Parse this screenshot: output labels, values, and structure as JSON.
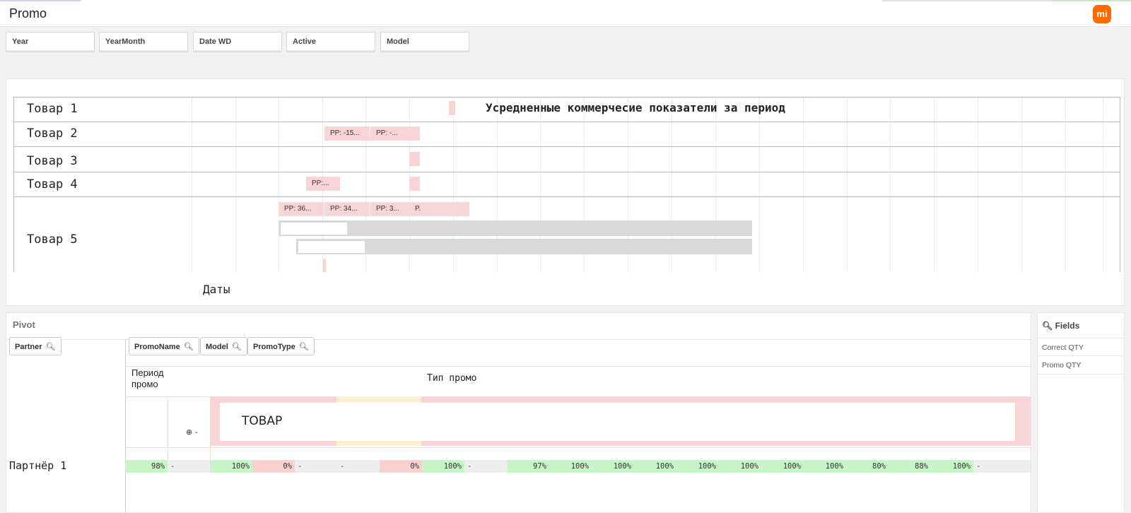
{
  "app": {
    "title": "Promo",
    "logo_text": "mi"
  },
  "filters": [
    "Year",
    "YearMonth",
    "Date WD",
    "Active",
    "Model"
  ],
  "gantt": {
    "title": "Усредненные коммерчесие показатели за период",
    "rows": [
      "Товар 1",
      "Товар 2",
      "Товар 3",
      "Товар 4",
      "Товар 5"
    ],
    "bar_labels": {
      "r2a": "PP: -15...",
      "r2b": "PP: -...",
      "r4a": "PP:...",
      "r5a": "PP: 36...",
      "r5b": "PP: 34...",
      "r5c": "PP: 3...",
      "r5d": "P."
    },
    "x_axis_label": "Даты"
  },
  "pivot": {
    "title": "Pivot",
    "row_dims": [
      "Partner"
    ],
    "col_dims": [
      "PromoName",
      "Model",
      "PromoType"
    ],
    "period_label": "Период промо",
    "type_label": "Тип промо",
    "group_label": "ТОВАР",
    "expander": "-",
    "partner": "Партнёр 1",
    "row_values": [
      "98%",
      "-",
      "100%",
      "0%",
      "-",
      "-",
      "0%",
      "100%",
      "-",
      "97%",
      "100%",
      "100%",
      "100%",
      "100%",
      "100%",
      "100%",
      "100%",
      "80%",
      "88%",
      "100%",
      "-"
    ]
  },
  "fields": {
    "title": "Fields",
    "items": [
      "Correct QTY",
      "Promo QTY"
    ]
  },
  "colors": {
    "accent": "#ff6900",
    "bar_pink": "#f9d4d4",
    "bar_grey": "#d9d9d9",
    "cell_green": "#c8f5c8",
    "cell_red": "#f9d0d0",
    "band_yellow": "#fbf0cf"
  }
}
